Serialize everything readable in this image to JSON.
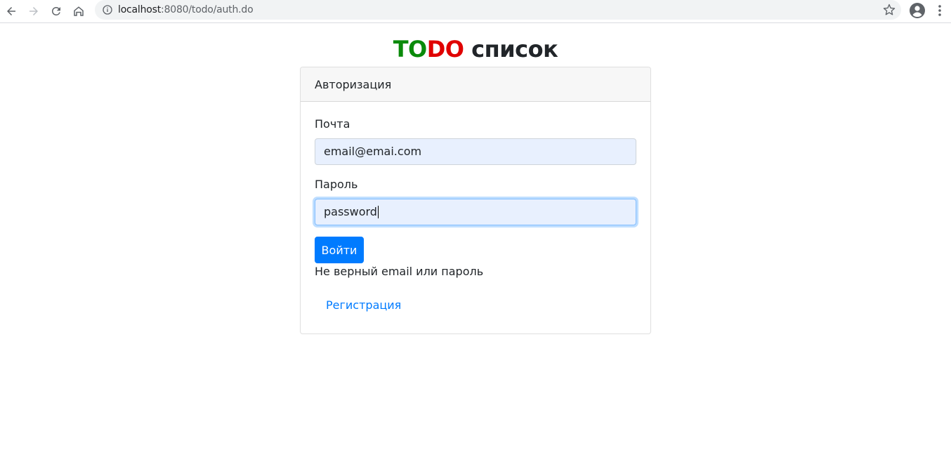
{
  "browser": {
    "url_host": "localhost",
    "url_rest": ":8080/todo/auth.do",
    "icons": [
      "back-arrow-icon",
      "forward-arrow-icon",
      "reload-icon",
      "home-icon",
      "info-icon",
      "star-icon",
      "profile-icon",
      "kebab-menu-icon"
    ]
  },
  "title": {
    "to": "TO",
    "do": "DO",
    "rest": " список",
    "colors": {
      "to": "#0a8a0a",
      "do": "#e00000",
      "rest": "#212529"
    }
  },
  "card": {
    "header": "Авторизация",
    "email_label": "Почта",
    "email_value": "email@emai.com",
    "password_label": "Пароль",
    "password_value": "password",
    "submit_label": "Войти",
    "error_message": "Не верный email или пароль",
    "register_link": "Регистрация"
  },
  "colors": {
    "primary": "#007bff",
    "input_autofill_bg": "#e8f0fe"
  }
}
